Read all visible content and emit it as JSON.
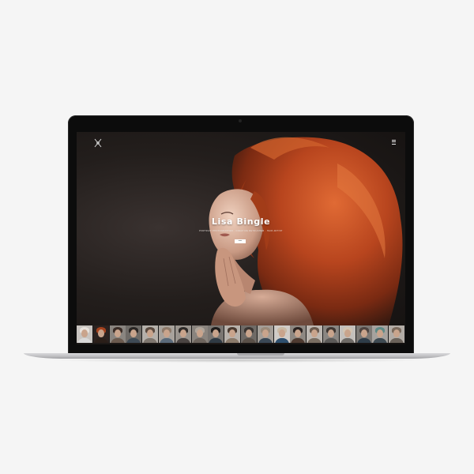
{
  "hero": {
    "title": "Lisa Bingle",
    "subtitle": "Portrait Photographer · Creative Retoucher · Hair Artist",
    "button_label": "more"
  },
  "header": {
    "logo_icon": "crossed-tools-logo-icon",
    "menu_icon": "hamburger-menu-icon"
  },
  "thumbnails": [
    {
      "hair": "#e8e2dc",
      "shirt": "#d8d8d8",
      "bg": "#c8c4c0"
    },
    {
      "hair": "#a3421e",
      "shirt": "#2a1e18",
      "bg": "#2b2220"
    },
    {
      "hair": "#3b2d27",
      "shirt": "#6b5a4e",
      "bg": "#8a8580"
    },
    {
      "hair": "#2a2624",
      "shirt": "#3e4a55",
      "bg": "#6e6a66"
    },
    {
      "hair": "#5a4a40",
      "shirt": "#7e766e",
      "bg": "#b5b0aa"
    },
    {
      "hair": "#8e7a6a",
      "shirt": "#5a6a7a",
      "bg": "#a8a29c"
    },
    {
      "hair": "#2e2a28",
      "shirt": "#4a4442",
      "bg": "#9a948e"
    },
    {
      "hair": "#b0a59a",
      "shirt": "#6e655e",
      "bg": "#8a847e"
    },
    {
      "hair": "#1f1c1b",
      "shirt": "#2f3a44",
      "bg": "#7a7672"
    },
    {
      "hair": "#4a3a30",
      "shirt": "#8a7a6a",
      "bg": "#b8b2ac"
    },
    {
      "hair": "#3a3431",
      "shirt": "#5a5048",
      "bg": "#6f6a66"
    },
    {
      "hair": "#9a8a7a",
      "shirt": "#3a4856",
      "bg": "#a49e98"
    },
    {
      "hair": "#c9b9a4",
      "shirt": "#2e4f6e",
      "bg": "#d0ccc8"
    },
    {
      "hair": "#2a2220",
      "shirt": "#4e3a30",
      "bg": "#8e8882"
    },
    {
      "hair": "#6a5a4e",
      "shirt": "#7a6e62",
      "bg": "#bdb7b1"
    },
    {
      "hair": "#3e3632",
      "shirt": "#5c5a58",
      "bg": "#8a8682"
    },
    {
      "hair": "#d2c4b2",
      "shirt": "#6e6a66",
      "bg": "#c4c0bc"
    },
    {
      "hair": "#4e4440",
      "shirt": "#2e3c48",
      "bg": "#7c7874"
    },
    {
      "hair": "#5e8a86",
      "shirt": "#3e4a52",
      "bg": "#a6a29e"
    },
    {
      "hair": "#7a6a5c",
      "shirt": "#6a625a",
      "bg": "#b2aca6"
    }
  ],
  "colors": {
    "hair_red": "#b8451e",
    "background_dark": "#231e1c",
    "bezel": "#0c0c0c",
    "page_background": "#f5f5f5"
  }
}
